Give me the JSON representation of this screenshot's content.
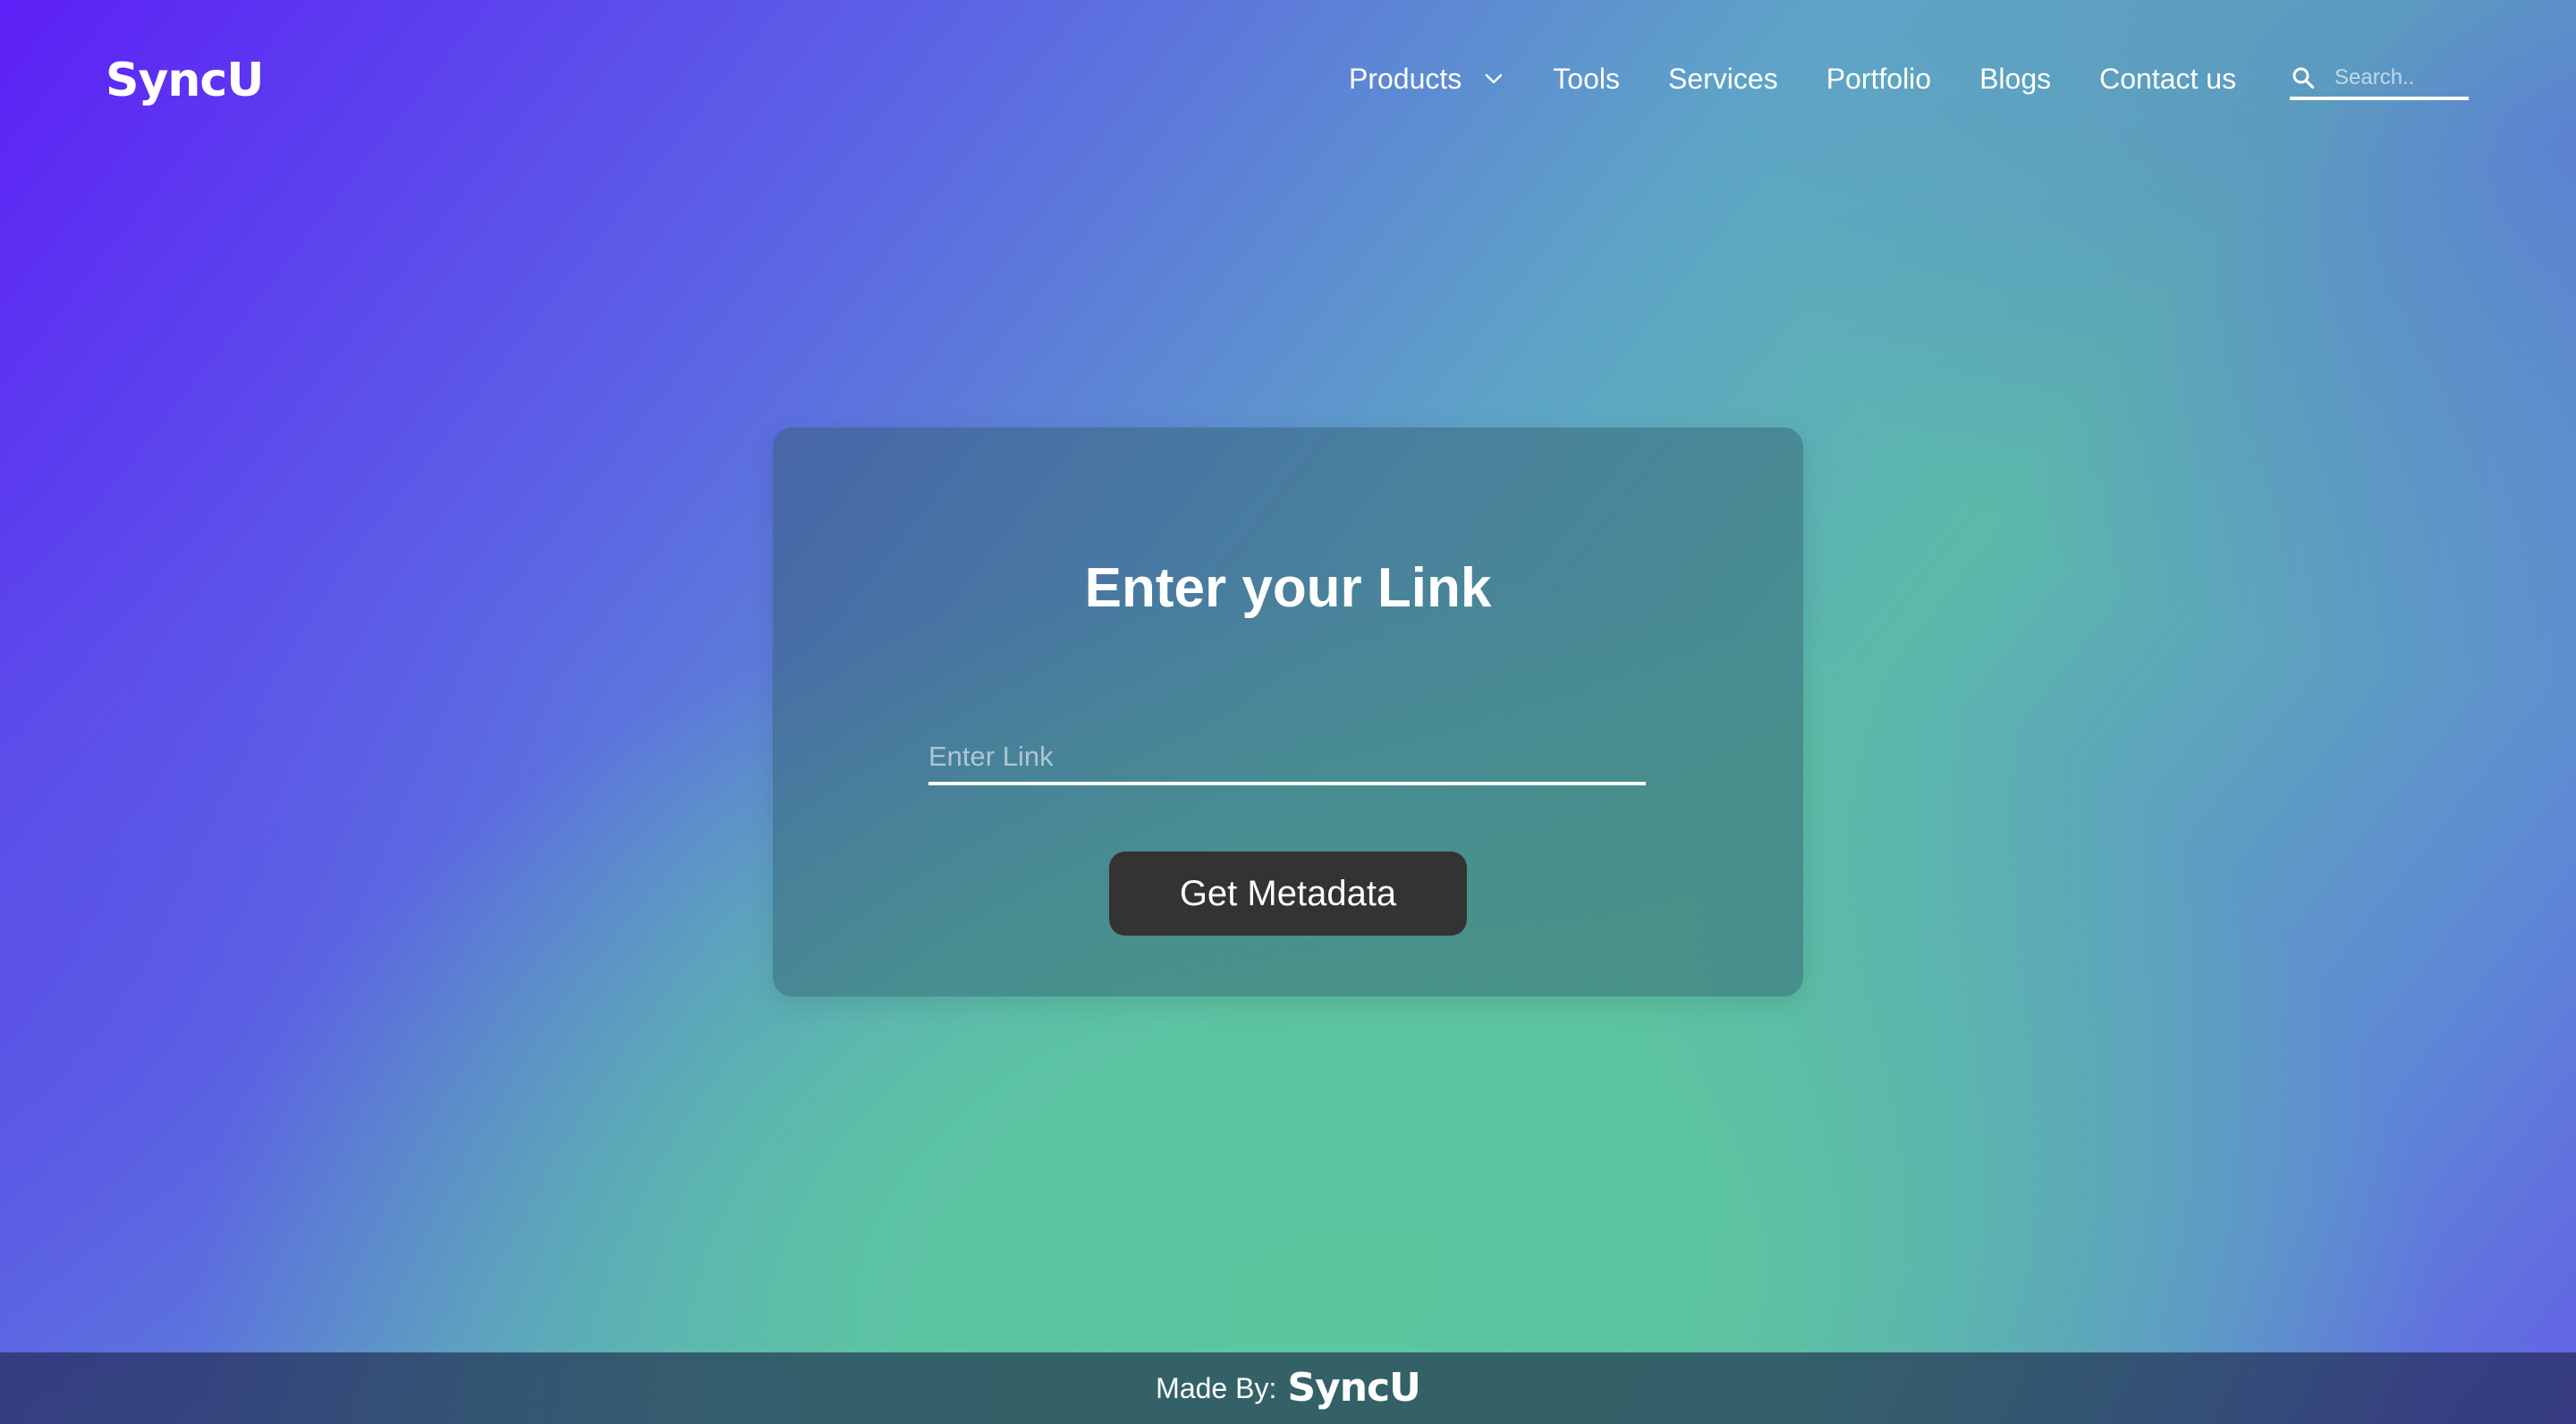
{
  "brand": {
    "logo_text": "SyncU"
  },
  "nav": {
    "items": [
      {
        "label": "Products",
        "has_dropdown": true
      },
      {
        "label": "Tools"
      },
      {
        "label": "Services"
      },
      {
        "label": "Portfolio"
      },
      {
        "label": "Blogs"
      },
      {
        "label": "Contact us"
      }
    ]
  },
  "search": {
    "placeholder": "Search..",
    "icon": "search-icon"
  },
  "card": {
    "title": "Enter your Link",
    "input_placeholder": "Enter Link",
    "input_value": "",
    "button_label": "Get Metadata"
  },
  "footer": {
    "made_by_label": "Made By:",
    "logo_text": "SyncU"
  },
  "colors": {
    "gradient_start": "#5d20f6",
    "gradient_center": "#5cc69f",
    "button_bg": "#333333",
    "text": "#ffffff"
  }
}
